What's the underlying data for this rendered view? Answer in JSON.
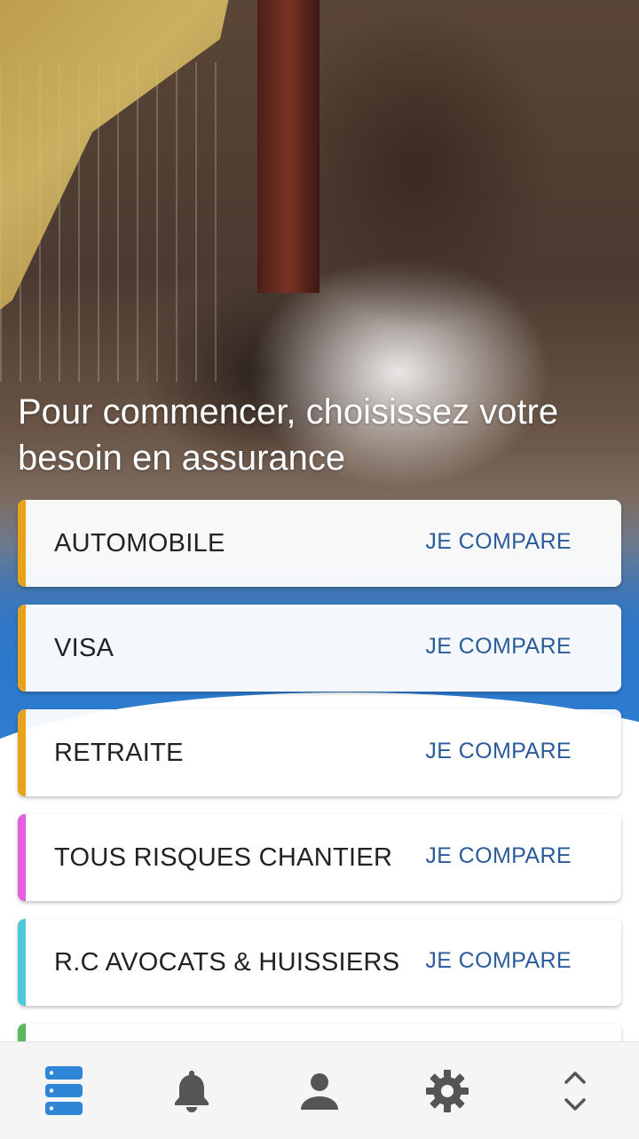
{
  "headline": "Pour commencer, choisissez votre besoin en assurance",
  "cards": [
    {
      "label": "AUTOMOBILE",
      "cta": "JE COMPARE",
      "accent": "#e8a21b"
    },
    {
      "label": "VISA",
      "cta": "JE COMPARE",
      "accent": "#e8a21b"
    },
    {
      "label": "RETRAITE",
      "cta": "JE COMPARE",
      "accent": "#e8a21b"
    },
    {
      "label": "TOUS RISQUES CHANTIER",
      "cta": "JE COMPARE",
      "accent": "#e060e0"
    },
    {
      "label": "R.C AVOCATS & HUISSIERS",
      "cta": "JE COMPARE",
      "accent": "#4cc8d8"
    },
    {
      "label": "",
      "cta": "",
      "accent": "#5cb85c"
    }
  ],
  "nav": [
    {
      "icon": "list-icon",
      "active": true
    },
    {
      "icon": "bell-icon",
      "active": false
    },
    {
      "icon": "person-icon",
      "active": false
    },
    {
      "icon": "gear-icon",
      "active": false
    },
    {
      "icon": "chevron-up-down-icon",
      "active": false
    }
  ],
  "colors": {
    "accent_active": "#2f86d6",
    "icon_inactive": "#555555",
    "cta_text": "#2a5b9c"
  }
}
